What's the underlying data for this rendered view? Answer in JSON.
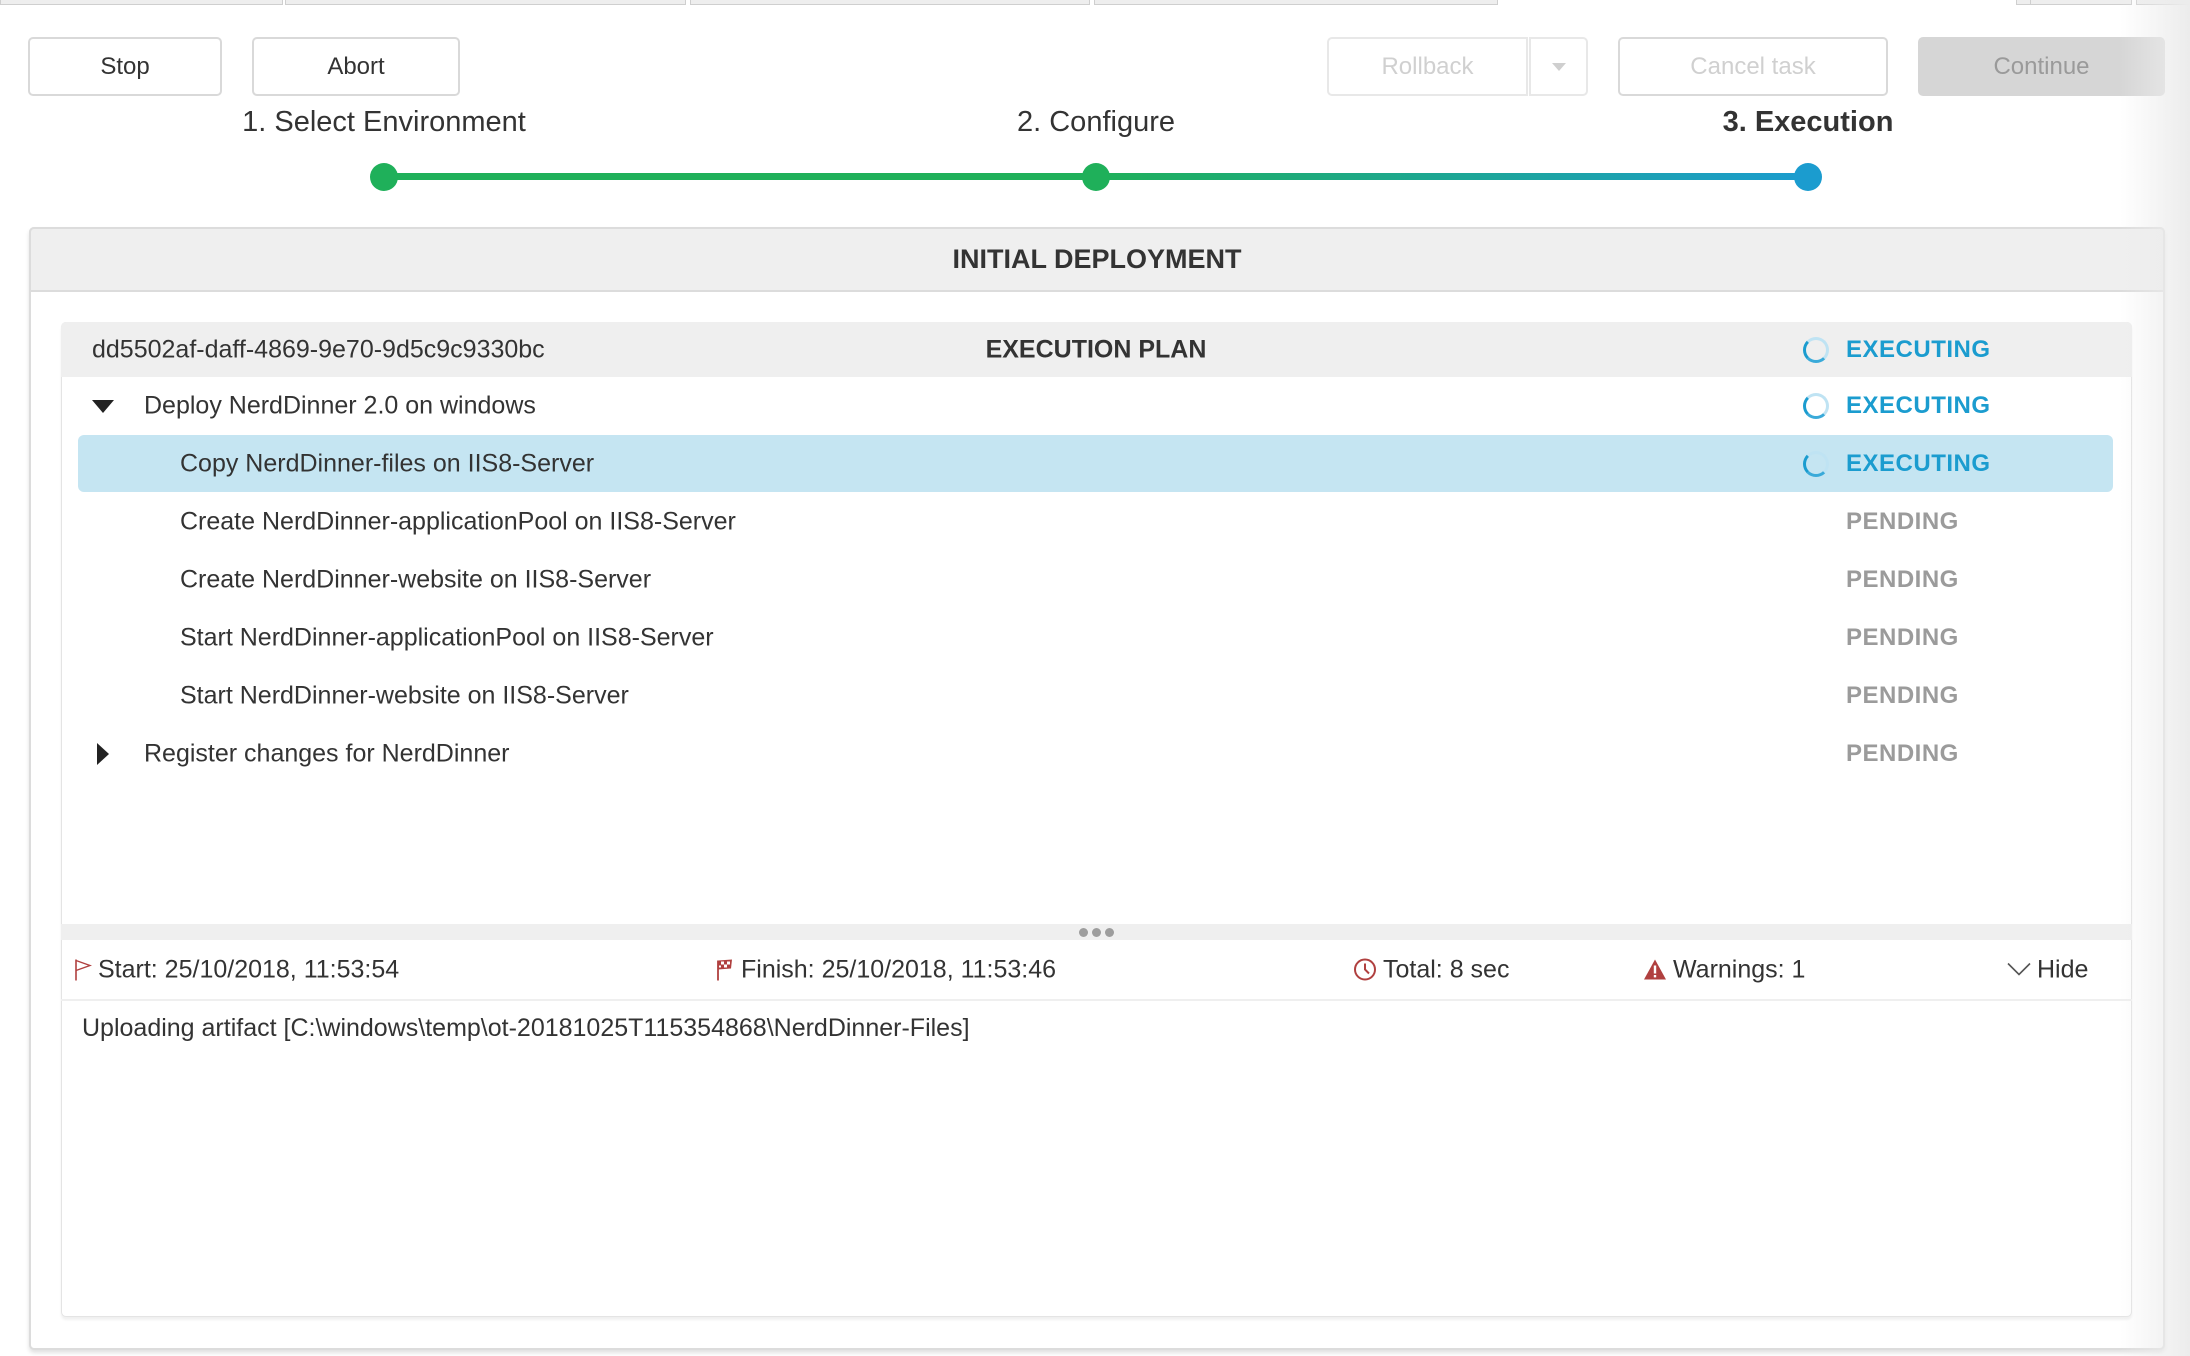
{
  "toolbar": {
    "stop_label": "Stop",
    "abort_label": "Abort",
    "rollback_label": "Rollback",
    "rollback_dropdown_icon": "caret-down-icon",
    "cancel_task_label": "Cancel task",
    "continue_label": "Continue"
  },
  "wizard": {
    "steps": [
      {
        "label": "1. Select Environment",
        "state": "done"
      },
      {
        "label": "2. Configure",
        "state": "done"
      },
      {
        "label": "3. Execution",
        "state": "active"
      }
    ],
    "colors": {
      "done": "#1fb05a",
      "active": "#1b9ccf"
    }
  },
  "panel": {
    "title": "INITIAL DEPLOYMENT"
  },
  "plan": {
    "id": "dd5502af-daff-4869-9e70-9d5c9c9330bc",
    "title": "EXECUTION PLAN",
    "status": "EXECUTING",
    "items": [
      {
        "label": "Deploy NerdDinner 2.0 on windows",
        "status": "EXECUTING",
        "expander": "expanded"
      },
      {
        "label": "Copy NerdDinner-files on IIS8-Server",
        "status": "EXECUTING",
        "selected": true
      },
      {
        "label": "Create NerdDinner-applicationPool on IIS8-Server",
        "status": "PENDING"
      },
      {
        "label": "Create NerdDinner-website on IIS8-Server",
        "status": "PENDING"
      },
      {
        "label": "Start NerdDinner-applicationPool on IIS8-Server",
        "status": "PENDING"
      },
      {
        "label": "Start NerdDinner-website on IIS8-Server",
        "status": "PENDING"
      },
      {
        "label": "Register changes for NerdDinner",
        "status": "PENDING",
        "expander": "collapsed"
      }
    ]
  },
  "details": {
    "start": "Start: 25/10/2018, 11:53:54",
    "finish": "Finish: 25/10/2018, 11:53:46",
    "total": "Total: 8 sec",
    "warnings": "Warnings: 1",
    "hide_label": "Hide",
    "log_line": "Uploading artifact [C:\\windows\\temp\\ot-20181025T115354868\\NerdDinner-Files]",
    "icon_color": "#b0403f"
  },
  "colors": {
    "executing": "#1b9ccf",
    "pending": "#9b9b9b",
    "selected_row": "#c5e5f2"
  }
}
